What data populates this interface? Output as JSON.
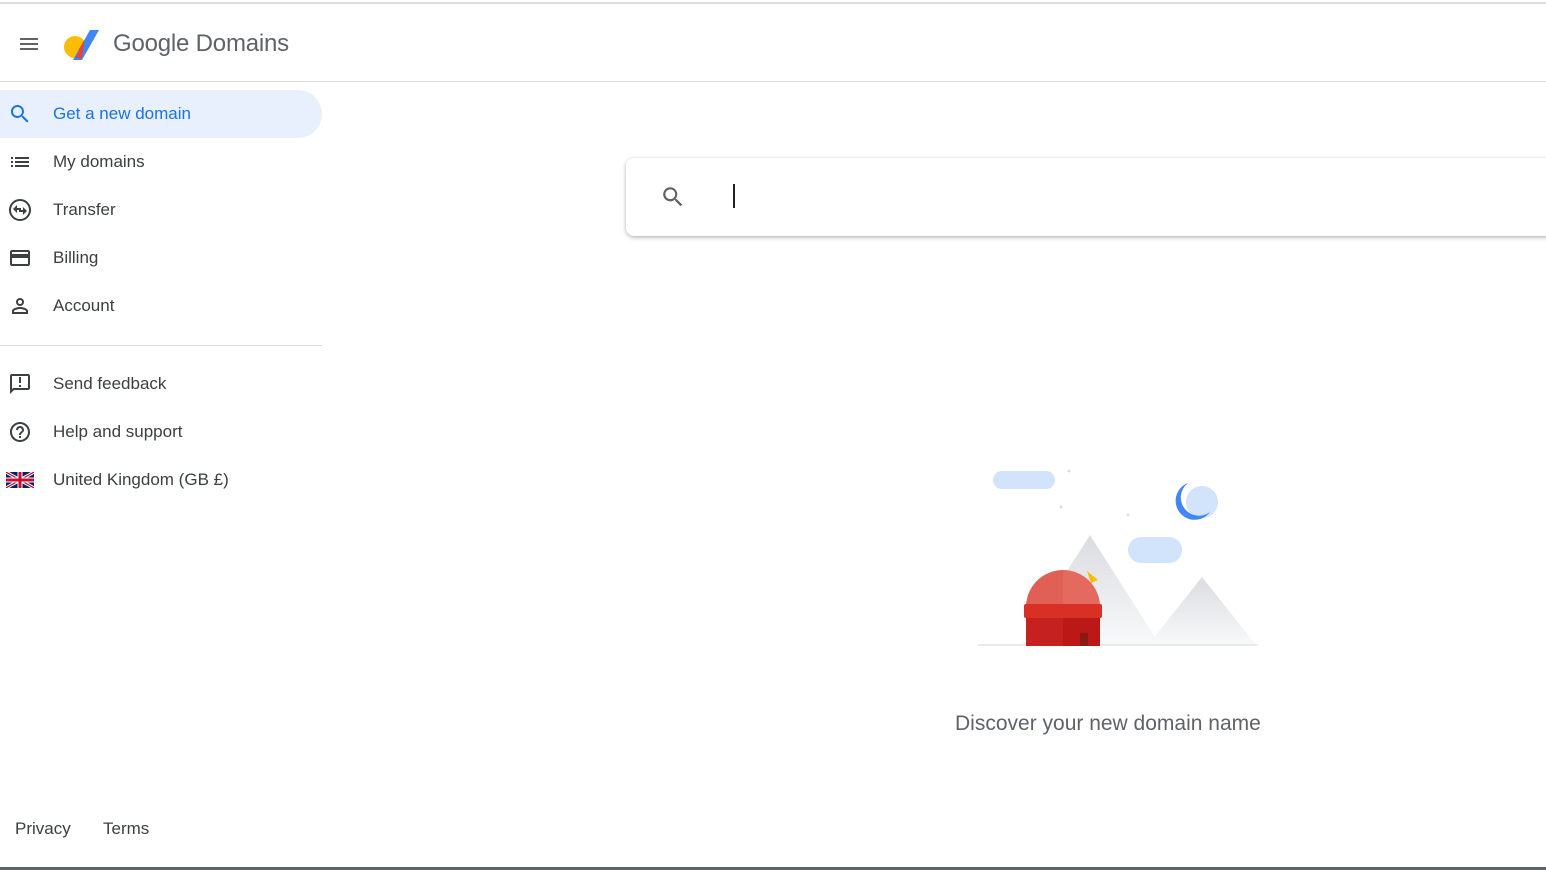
{
  "header": {
    "brand": "Google Domains",
    "menu_icon": "hamburger-menu-icon",
    "logo_icon": "google-domains-logo"
  },
  "sidebar": {
    "items": [
      {
        "label": "Get a new domain",
        "icon": "search-icon",
        "active": true
      },
      {
        "label": "My domains",
        "icon": "list-icon"
      },
      {
        "label": "Transfer",
        "icon": "transfer-icon"
      },
      {
        "label": "Billing",
        "icon": "credit-card-icon"
      },
      {
        "label": "Account",
        "icon": "person-icon"
      }
    ],
    "secondary": [
      {
        "label": "Send feedback",
        "icon": "feedback-icon"
      },
      {
        "label": "Help and support",
        "icon": "help-icon"
      },
      {
        "label": "United Kingdom (GB £)",
        "icon": "uk-flag-icon"
      }
    ],
    "footer": {
      "privacy": "Privacy",
      "terms": "Terms"
    }
  },
  "search": {
    "value": "",
    "placeholder": ""
  },
  "main": {
    "discover_text": "Discover your new domain name"
  },
  "colors": {
    "accent": "#1a73e8",
    "active_bg": "#e8f0fe",
    "text": "#3c4043",
    "red": "#d93025",
    "yellow": "#fbbc04"
  }
}
